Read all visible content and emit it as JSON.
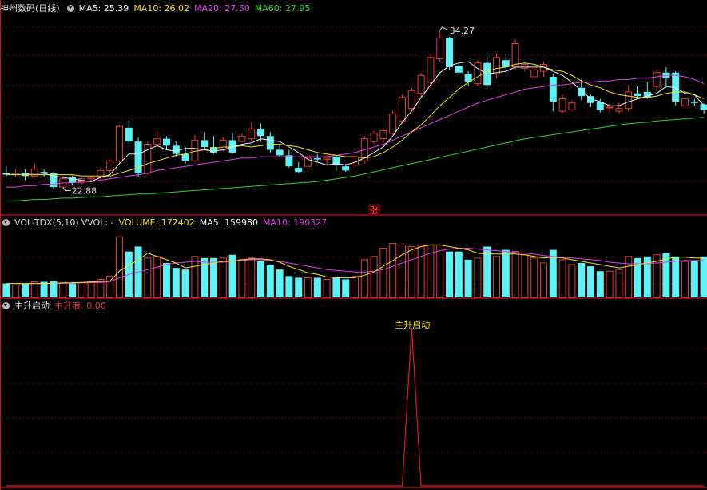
{
  "colors": {
    "up": "#e83a3a",
    "down": "#5ef2f6",
    "ma5": "#f0f0f0",
    "ma10": "#f2e42a",
    "ma20": "#e040e8",
    "ma60": "#38cf38",
    "grid": "#8a1010"
  },
  "price_panel": {
    "title": "神州数码(日线)",
    "ma_labels": [
      {
        "key": "ma5",
        "text": "MA5: 25.39"
      },
      {
        "key": "ma10",
        "text": "MA10: 26.02"
      },
      {
        "key": "ma20",
        "text": "MA20: 27.50"
      },
      {
        "key": "ma60",
        "text": "MA60: 27.95"
      }
    ],
    "high_label": "34.27",
    "low_label": "22.88",
    "rise_mark": "涨"
  },
  "volume_panel": {
    "title": "VOL-TDX(5,10)",
    "labels": [
      {
        "key": "vvol",
        "text": "VVOL: -"
      },
      {
        "key": "vol",
        "text": "VOLUME: 172402"
      },
      {
        "key": "ma5",
        "text": "MA5: 159980"
      },
      {
        "key": "ma10",
        "text": "MA10: 190327"
      }
    ]
  },
  "signal_panel": {
    "title": "主升启动",
    "value_label": "主升浪: 0.00",
    "signal_text": "主升启动"
  },
  "chart_data": {
    "type": "candlestick",
    "price_range": [
      21.4,
      35.3
    ],
    "ohlc": [
      [
        23.9,
        24.4,
        23.6,
        23.8
      ],
      [
        23.8,
        24.2,
        23.6,
        23.9
      ],
      [
        23.9,
        24.2,
        23.4,
        23.7
      ],
      [
        23.7,
        24.6,
        23.6,
        24.2
      ],
      [
        24.0,
        24.2,
        23.6,
        23.9
      ],
      [
        23.9,
        24.0,
        22.8,
        22.9
      ],
      [
        22.9,
        23.7,
        22.88,
        23.5
      ],
      [
        23.6,
        23.7,
        23.0,
        23.2
      ],
      [
        23.2,
        23.6,
        23.1,
        23.5
      ],
      [
        23.5,
        23.7,
        23.3,
        23.6
      ],
      [
        23.6,
        24.3,
        23.4,
        24.1
      ],
      [
        24.1,
        24.9,
        23.9,
        24.8
      ],
      [
        24.8,
        27.4,
        24.7,
        27.3
      ],
      [
        27.2,
        27.7,
        26.0,
        26.2
      ],
      [
        26.2,
        26.5,
        23.6,
        23.9
      ],
      [
        23.9,
        26.2,
        23.8,
        26.0
      ],
      [
        26.0,
        27.0,
        25.7,
        26.4
      ],
      [
        26.4,
        26.6,
        25.6,
        25.9
      ],
      [
        25.9,
        26.2,
        25.1,
        25.3
      ],
      [
        25.3,
        25.8,
        24.6,
        24.8
      ],
      [
        24.8,
        26.7,
        24.7,
        26.3
      ],
      [
        26.3,
        26.9,
        25.6,
        25.8
      ],
      [
        25.8,
        26.6,
        25.3,
        25.4
      ],
      [
        25.6,
        26.5,
        25.5,
        26.3
      ],
      [
        26.3,
        26.8,
        25.3,
        25.4
      ],
      [
        26.2,
        26.8,
        26.2,
        26.6
      ],
      [
        26.4,
        27.6,
        26.2,
        27.1
      ],
      [
        27.1,
        27.5,
        26.2,
        26.6
      ],
      [
        26.6,
        26.9,
        25.4,
        25.6
      ],
      [
        25.6,
        26.0,
        25.1,
        25.2
      ],
      [
        25.2,
        25.6,
        24.3,
        24.4
      ],
      [
        24.3,
        24.7,
        23.9,
        24.0
      ],
      [
        24.4,
        25.3,
        24.2,
        25.0
      ],
      [
        25.0,
        25.3,
        24.8,
        24.9
      ],
      [
        24.9,
        25.2,
        24.5,
        25.0
      ],
      [
        25.1,
        25.2,
        24.1,
        24.5
      ],
      [
        24.4,
        24.6,
        24.0,
        24.1
      ],
      [
        24.5,
        25.3,
        24.3,
        25.1
      ],
      [
        24.8,
        26.6,
        24.6,
        26.4
      ],
      [
        26.2,
        27.0,
        26.0,
        26.8
      ],
      [
        26.4,
        27.2,
        26.1,
        27.0
      ],
      [
        26.8,
        28.4,
        26.7,
        28.2
      ],
      [
        27.7,
        29.6,
        27.5,
        29.4
      ],
      [
        28.6,
        30.1,
        28.4,
        29.9
      ],
      [
        29.7,
        31.2,
        29.4,
        31.0
      ],
      [
        30.5,
        32.5,
        30.3,
        32.3
      ],
      [
        32.2,
        34.27,
        32.0,
        33.7
      ],
      [
        33.7,
        33.8,
        31.4,
        31.6
      ],
      [
        31.7,
        32.0,
        31.0,
        31.2
      ],
      [
        31.1,
        31.3,
        30.2,
        30.5
      ],
      [
        30.4,
        32.1,
        30.2,
        31.9
      ],
      [
        31.9,
        32.4,
        30.0,
        30.3
      ],
      [
        31.1,
        32.6,
        30.8,
        32.3
      ],
      [
        32.1,
        32.6,
        31.2,
        31.6
      ],
      [
        31.6,
        33.6,
        31.4,
        33.3
      ],
      [
        31.5,
        31.9,
        31.3,
        31.8
      ],
      [
        30.9,
        31.6,
        30.7,
        31.4
      ],
      [
        31.3,
        32.0,
        30.9,
        31.8
      ],
      [
        30.9,
        31.1,
        28.4,
        29.1
      ],
      [
        28.4,
        29.6,
        28.3,
        29.3
      ],
      [
        28.5,
        29.2,
        28.4,
        29.0
      ],
      [
        30.1,
        30.7,
        29.2,
        29.5
      ],
      [
        29.5,
        29.6,
        28.7,
        29.0
      ],
      [
        29.1,
        29.3,
        28.3,
        28.5
      ],
      [
        28.7,
        29.0,
        28.3,
        28.7
      ],
      [
        28.4,
        29.0,
        28.2,
        28.6
      ],
      [
        28.6,
        30.3,
        28.4,
        29.8
      ],
      [
        29.7,
        30.2,
        29.3,
        29.5
      ],
      [
        29.8,
        30.5,
        29.3,
        29.4
      ],
      [
        30.2,
        31.4,
        29.9,
        31.2
      ],
      [
        31.2,
        31.6,
        30.1,
        30.8
      ],
      [
        31.2,
        31.3,
        28.8,
        29.1
      ],
      [
        28.8,
        29.4,
        28.6,
        29.3
      ],
      [
        29.1,
        29.3,
        28.8,
        29.0
      ],
      [
        28.9,
        29.0,
        28.2,
        28.5
      ],
      [
        28.5,
        28.7,
        24.4,
        24.7
      ]
    ],
    "ma5": [
      23.9,
      23.9,
      23.9,
      23.9,
      23.9,
      23.7,
      23.6,
      23.5,
      23.4,
      23.3,
      23.6,
      23.8,
      24.6,
      25.3,
      25.3,
      25.6,
      25.9,
      25.6,
      25.5,
      25.7,
      25.7,
      25.6,
      25.5,
      25.6,
      25.8,
      26.0,
      26.1,
      26.4,
      26.3,
      26.2,
      25.8,
      25.4,
      24.9,
      24.7,
      24.5,
      24.6,
      24.5,
      24.7,
      25.0,
      25.4,
      25.8,
      26.6,
      27.6,
      28.4,
      29.4,
      30.3,
      31.2,
      31.7,
      31.9,
      32.0,
      31.5,
      31.1,
      31.2,
      31.3,
      31.6,
      31.6,
      31.6,
      31.6,
      31.3,
      31.0,
      30.5,
      29.9,
      29.3,
      29.1,
      28.8,
      28.8,
      29.1,
      29.3,
      29.5,
      29.7,
      30.2,
      30.1,
      29.7,
      29.6,
      28.8
    ],
    "ma10": [
      23.8,
      23.8,
      23.8,
      23.8,
      23.8,
      23.8,
      23.8,
      23.8,
      23.7,
      23.7,
      23.7,
      23.7,
      23.9,
      24.1,
      24.3,
      24.6,
      24.8,
      25.0,
      25.2,
      25.3,
      25.5,
      25.6,
      25.7,
      25.8,
      25.8,
      25.9,
      25.8,
      25.9,
      26.0,
      26.0,
      25.9,
      25.8,
      25.6,
      25.4,
      25.3,
      25.2,
      25.1,
      25.1,
      25.0,
      25.1,
      25.4,
      25.8,
      26.3,
      26.9,
      27.4,
      28.1,
      28.8,
      29.4,
      30.0,
      30.5,
      30.9,
      31.3,
      31.5,
      31.6,
      31.8,
      31.9,
      31.8,
      31.6,
      31.4,
      31.3,
      31.0,
      30.6,
      30.3,
      30.1,
      29.8,
      29.6,
      29.5,
      29.4,
      29.4,
      29.5,
      29.7,
      29.8,
      29.8,
      29.6,
      29.3
    ],
    "ma20": [
      22.9,
      22.9,
      23.0,
      23.0,
      23.1,
      23.1,
      23.2,
      23.2,
      23.3,
      23.3,
      23.4,
      23.5,
      23.6,
      23.7,
      23.8,
      23.9,
      24.1,
      24.2,
      24.3,
      24.4,
      24.5,
      24.6,
      24.7,
      24.8,
      24.9,
      25.0,
      25.0,
      25.1,
      25.1,
      25.1,
      25.1,
      25.1,
      25.1,
      25.1,
      25.1,
      25.2,
      25.3,
      25.4,
      25.6,
      25.8,
      26.0,
      26.3,
      26.6,
      26.9,
      27.2,
      27.5,
      27.8,
      28.1,
      28.4,
      28.7,
      29.0,
      29.2,
      29.4,
      29.6,
      29.8,
      30.0,
      30.1,
      30.2,
      30.3,
      30.3,
      30.4,
      30.5,
      30.5,
      30.6,
      30.6,
      30.7,
      30.7,
      30.8,
      30.8,
      30.9,
      31.0,
      31.0,
      30.9,
      30.7,
      30.4
    ],
    "ma60": [
      21.9,
      21.9,
      21.95,
      22.0,
      22.0,
      22.05,
      22.1,
      22.1,
      22.15,
      22.2,
      22.2,
      22.25,
      22.3,
      22.35,
      22.4,
      22.4,
      22.45,
      22.5,
      22.55,
      22.6,
      22.65,
      22.7,
      22.75,
      22.8,
      22.85,
      22.9,
      22.95,
      23.0,
      23.05,
      23.1,
      23.15,
      23.2,
      23.25,
      23.3,
      23.4,
      23.5,
      23.6,
      23.7,
      23.85,
      24.0,
      24.15,
      24.3,
      24.45,
      24.6,
      24.75,
      24.9,
      25.05,
      25.2,
      25.35,
      25.5,
      25.65,
      25.8,
      25.95,
      26.1,
      26.25,
      26.4,
      26.5,
      26.6,
      26.7,
      26.8,
      26.9,
      27.0,
      27.1,
      27.2,
      27.3,
      27.4,
      27.5,
      27.55,
      27.6,
      27.7,
      27.75,
      27.8,
      27.85,
      27.9,
      27.95
    ],
    "volume": [
      85,
      75,
      85,
      95,
      95,
      100,
      90,
      85,
      90,
      95,
      110,
      130,
      370,
      280,
      310,
      240,
      250,
      210,
      180,
      170,
      250,
      240,
      240,
      240,
      260,
      230,
      240,
      220,
      200,
      170,
      130,
      120,
      120,
      120,
      110,
      120,
      110,
      130,
      230,
      250,
      300,
      330,
      320,
      310,
      320,
      320,
      320,
      280,
      280,
      230,
      240,
      310,
      250,
      290,
      280,
      260,
      240,
      210,
      290,
      230,
      200,
      210,
      190,
      160,
      160,
      170,
      250,
      240,
      250,
      260,
      270,
      250,
      220,
      220,
      250
    ],
    "volume_range": [
      0,
      410
    ],
    "vol_ma5": [
      85,
      85,
      85,
      85,
      85,
      86,
      88,
      90,
      92,
      94,
      97,
      100,
      160,
      195,
      230,
      270,
      250,
      230,
      210,
      180,
      190,
      200,
      210,
      220,
      220,
      230,
      235,
      235,
      230,
      215,
      190,
      170,
      150,
      140,
      125,
      120,
      118,
      120,
      135,
      155,
      190,
      225,
      260,
      290,
      310,
      320,
      320,
      310,
      300,
      290,
      270,
      265,
      265,
      265,
      265,
      260,
      250,
      240,
      245,
      240,
      230,
      220,
      210,
      200,
      190,
      180,
      190,
      200,
      210,
      220,
      235,
      245,
      245,
      240,
      240
    ],
    "vol_ma10": [
      85,
      85,
      85,
      85,
      85,
      86,
      87,
      88,
      89,
      90,
      92,
      95,
      120,
      140,
      155,
      170,
      185,
      200,
      210,
      215,
      220,
      215,
      215,
      215,
      220,
      225,
      230,
      230,
      225,
      220,
      210,
      200,
      190,
      180,
      170,
      165,
      160,
      155,
      155,
      160,
      170,
      190,
      210,
      230,
      250,
      270,
      285,
      295,
      300,
      300,
      295,
      290,
      285,
      280,
      275,
      270,
      265,
      255,
      250,
      245,
      240,
      235,
      230,
      225,
      215,
      210,
      205,
      205,
      205,
      210,
      215,
      220,
      225,
      225,
      225
    ],
    "signal": [
      0,
      0,
      0,
      0,
      0,
      0,
      0,
      0,
      0,
      0,
      0,
      0,
      0,
      0,
      0,
      0,
      0,
      0,
      0,
      0,
      0,
      0,
      0,
      0,
      0,
      0,
      0,
      0,
      0,
      0,
      0,
      0,
      0,
      0,
      0,
      0,
      0,
      0,
      0,
      0,
      0,
      0,
      0,
      1,
      0,
      0,
      0,
      0,
      0,
      0,
      0,
      0,
      0,
      0,
      0,
      0,
      0,
      0,
      0,
      0,
      0,
      0,
      0,
      0,
      0,
      0,
      0,
      0,
      0,
      0,
      0,
      0,
      0,
      0,
      0
    ],
    "rise_index": 39,
    "high_index": 46,
    "low_index": 6
  }
}
